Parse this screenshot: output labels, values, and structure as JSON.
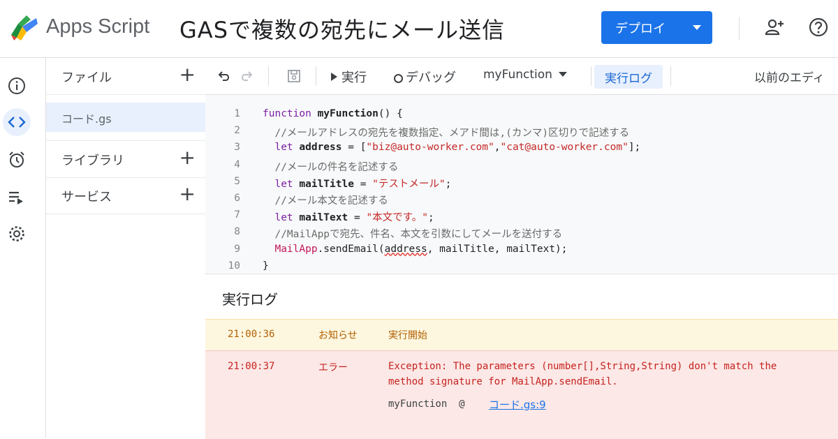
{
  "header": {
    "app_name": "Apps Script",
    "project_title": "GASで複数の宛先にメール送信",
    "deploy_label": "デプロイ",
    "icons": [
      "apps-script-logo-icon",
      "add-person-icon",
      "help-icon"
    ]
  },
  "rail": {
    "icons": [
      "info-icon",
      "code-icon",
      "alarm-icon",
      "executions-icon",
      "gear-icon"
    ],
    "active": "code-icon"
  },
  "files": {
    "files_label": "ファイル",
    "file_name": "コード.gs",
    "libraries_label": "ライブラリ",
    "services_label": "サービス"
  },
  "toolbar": {
    "run_label": "実行",
    "debug_label": "デバッグ",
    "function_select": "myFunction",
    "log_button": "実行ログ",
    "legacy_editor": "以前のエディ"
  },
  "code": {
    "lines": [
      {
        "n": "1",
        "tokens": [
          {
            "t": "kw",
            "v": "function "
          },
          {
            "t": "fn",
            "v": "myFunction"
          },
          {
            "t": "plain",
            "v": "() {"
          }
        ]
      },
      {
        "n": "2",
        "tokens": [
          {
            "t": "cmt",
            "v": "  //メールアドレスの宛先を複数指定、メアド間は,(カンマ)区切りで記述する"
          }
        ]
      },
      {
        "n": "3",
        "tokens": [
          {
            "t": "kw",
            "v": "  let "
          },
          {
            "t": "fn",
            "v": "address"
          },
          {
            "t": "plain",
            "v": " = ["
          },
          {
            "t": "str",
            "v": "\"biz@auto-worker.com\""
          },
          {
            "t": "plain",
            "v": ","
          },
          {
            "t": "str",
            "v": "\"cat@auto-worker.com\""
          },
          {
            "t": "plain",
            "v": "];"
          }
        ]
      },
      {
        "n": "4",
        "tokens": [
          {
            "t": "cmt",
            "v": "  //メールの件名を記述する"
          }
        ]
      },
      {
        "n": "5",
        "tokens": [
          {
            "t": "kw",
            "v": "  let "
          },
          {
            "t": "fn",
            "v": "mailTitle"
          },
          {
            "t": "plain",
            "v": " = "
          },
          {
            "t": "str",
            "v": "\"テストメール\""
          },
          {
            "t": "plain",
            "v": ";"
          }
        ]
      },
      {
        "n": "6",
        "tokens": [
          {
            "t": "cmt",
            "v": "  //メール本文を記述する"
          }
        ]
      },
      {
        "n": "7",
        "tokens": [
          {
            "t": "kw",
            "v": "  let "
          },
          {
            "t": "fn",
            "v": "mailText"
          },
          {
            "t": "plain",
            "v": " = "
          },
          {
            "t": "str",
            "v": "\"本文です。\""
          },
          {
            "t": "plain",
            "v": ";"
          }
        ]
      },
      {
        "n": "8",
        "tokens": [
          {
            "t": "cmt",
            "v": "  //MailAppで宛先、件名、本文を引数にしてメールを送付する"
          }
        ]
      },
      {
        "n": "9",
        "tokens": [
          {
            "t": "cls",
            "v": "  MailApp"
          },
          {
            "t": "plain",
            "v": ".sendEmail("
          },
          {
            "t": "und",
            "v": "address"
          },
          {
            "t": "plain",
            "v": ", mailTitle, mailText);"
          }
        ]
      },
      {
        "n": "10",
        "tokens": [
          {
            "t": "plain",
            "v": "}"
          }
        ]
      }
    ]
  },
  "log": {
    "title": "実行ログ",
    "rows": [
      {
        "time": "21:00:36",
        "severity": "お知らせ",
        "message": "実行開始"
      },
      {
        "time": "21:00:37",
        "severity": "エラー",
        "message_line1": "Exception: The parameters (number[],String,String) don't match the",
        "message_line2": "method signature for MailApp.sendEmail.",
        "trace_fn": "myFunction  @",
        "trace_link": "コード.gs:9"
      }
    ]
  },
  "colors": {
    "accent": "#1a73e8",
    "info_bg": "#fef7e0",
    "error_bg": "#fce8e6",
    "info_text": "#b06000",
    "error_text": "#c5221f"
  }
}
